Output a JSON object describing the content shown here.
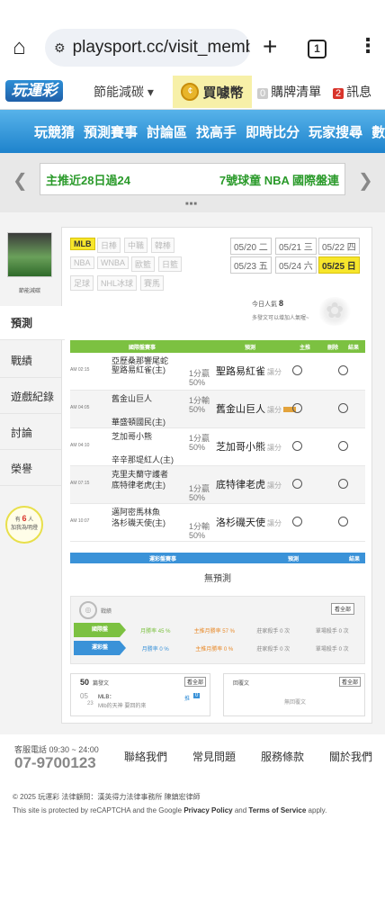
{
  "browser": {
    "url": "playsport.cc/visit_membe",
    "tab_count": "1"
  },
  "header": {
    "logo": "玩運彩",
    "energy": "節能減碳",
    "coin": "買噱幣",
    "coin_glyph": "¢",
    "cart_num": "0",
    "cart": "購牌清單",
    "msg_num": "2",
    "msg": "訊息"
  },
  "nav": [
    "玩競猜",
    "預測賽事",
    "討論區",
    "找高手",
    "即時比分",
    "玩家搜尋",
    "數據"
  ],
  "ticker": {
    "left": "主推近28日過24",
    "right": "7號球童 NBA 國際盤連"
  },
  "profile": {
    "name": "節能減碳"
  },
  "sidebar": [
    "預測",
    "戰績",
    "遊戲紀錄",
    "討論",
    "榮譽"
  ],
  "fans": {
    "pre": "有",
    "count": "6",
    "unit": "人",
    "post": "加我為明燈"
  },
  "leagues": [
    "MLB",
    "日棒",
    "中職",
    "韓棒",
    "NBA",
    "WNBA",
    "歐籃",
    "日籃",
    "足球",
    "NHL冰球",
    "賽馬"
  ],
  "dates": [
    "05/20 二",
    "05/21 三",
    "05/22 四",
    "05/23 五",
    "05/24 六",
    "05/25 日"
  ],
  "today": {
    "label": "今日人氣",
    "value": "8",
    "hint": "多發文可以增加人氣喔~"
  },
  "table": {
    "headers": [
      "國際盤賽事",
      "預測",
      "主推",
      "刪除",
      "結果"
    ],
    "rows": [
      {
        "time": "AM 02:15",
        "team1": "亞歷桑那響尾蛇",
        "team2": "聖路易紅雀(主)",
        "line": "1分贏",
        "pct": "50%",
        "pick": "聖路易紅雀",
        "tag": "讓分"
      },
      {
        "time": "AM 04:05",
        "team1": "舊金山巨人",
        "team2": "華盛頓國民(主)",
        "line": "1分輸",
        "pct": "50%",
        "pick": "舊金山巨人",
        "tag": "讓分"
      },
      {
        "time": "AM 04:10",
        "team1": "芝加哥小熊",
        "team2": "辛辛那堤紅人(主)",
        "line": "1分贏",
        "pct": "50%",
        "pick": "芝加哥小熊",
        "tag": "讓分"
      },
      {
        "time": "AM 07:15",
        "team1": "克里夫蘭守護者",
        "team2": "底特律老虎(主)",
        "line": "1分贏",
        "pct": "50%",
        "pick": "底特律老虎",
        "tag": "讓分"
      },
      {
        "time": "AM 10:07",
        "team1": "邁阿密馬林魚",
        "team2": "洛杉磯天使(主)",
        "line": "1分輸",
        "pct": "50%",
        "pick": "洛杉磯天使",
        "tag": "讓分"
      }
    ]
  },
  "lottery": {
    "headers": [
      "運彩盤賽事",
      "預測",
      "結果"
    ],
    "empty": "無預測"
  },
  "stats": {
    "title": "戰績",
    "all": "看全部",
    "rows": [
      {
        "tag": "國際盤",
        "color": "#7cc141",
        "month": "月勝率 45 %",
        "main": "主推月勝率 57 %",
        "fav": "莊家殺手 0 次",
        "single": "單場殺手 0 次"
      },
      {
        "tag": "運彩盤",
        "color": "#3a92d8",
        "month": "月勝率 0 %",
        "main": "主推月勝率 0 %",
        "fav": "莊家殺手 0 次",
        "single": "單場殺手 0 次"
      }
    ]
  },
  "posts": {
    "count": "50",
    "title": "篇發文",
    "all": "看全部",
    "day": "05",
    "month": "23",
    "item": "MLB：",
    "item2": "Mlb的天神 要回的來",
    "reply": "推",
    "reply_n": "0"
  },
  "replies": {
    "title": "回覆文",
    "all": "看全部",
    "empty": "無回覆文"
  },
  "footer": {
    "phone_label": "客服電話 09:30 ~ 24:00",
    "phone": "07-9700123",
    "links": [
      "聯絡我們",
      "常見問題",
      "服務條款",
      "關於我們"
    ],
    "copyright": "© 2025 玩運彩  法律顧問：漢英得力法律事務所 陳鎮宏律師",
    "recaptcha": "This site is protected by reCAPTCHA and the Google",
    "pp": "Privacy Policy",
    "and": "and",
    "tos": "Terms of Service",
    "apply": "apply."
  }
}
